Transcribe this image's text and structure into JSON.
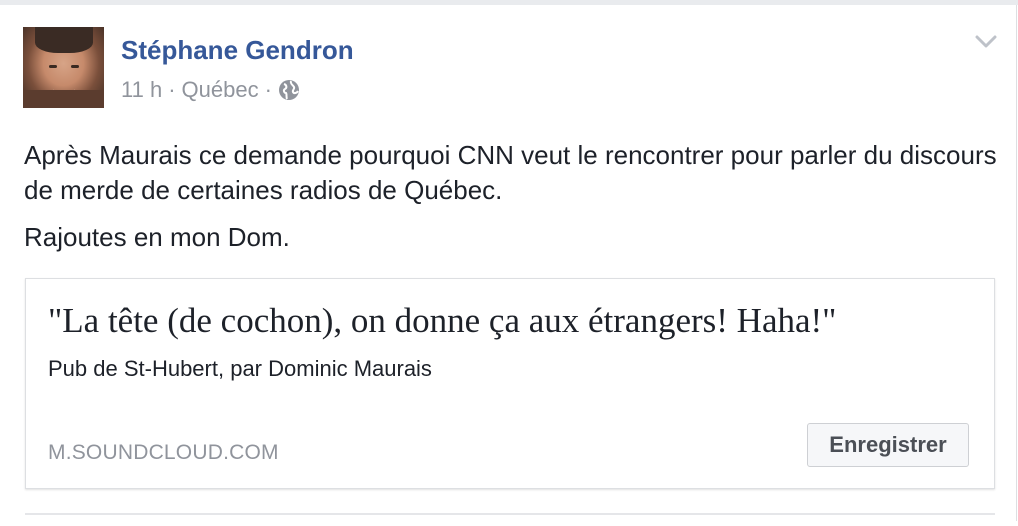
{
  "post": {
    "author": "Stéphane Gendron",
    "time": "11 h",
    "separator": "·",
    "location": "Québec",
    "privacy_icon": "globe-icon",
    "menu_icon": "chevron-down-icon",
    "text_paragraph_1": "Après Maurais ce demande pourquoi CNN veut le rencontrer pour parler du discours de merde de certaines radios de Québec.",
    "text_paragraph_2": "Rajoutes en mon Dom."
  },
  "link_card": {
    "title": "\"La tête (de cochon), on donne ça aux étrangers! Haha!\"",
    "description": "Pub de St-Hubert, par Dominic Maurais",
    "domain": "M.SOUNDCLOUD.COM",
    "save_label": "Enregistrer"
  },
  "colors": {
    "author_link": "#365899",
    "meta_gray": "#90949c",
    "body_text": "#1d2129",
    "button_bg": "#f6f7f9"
  }
}
